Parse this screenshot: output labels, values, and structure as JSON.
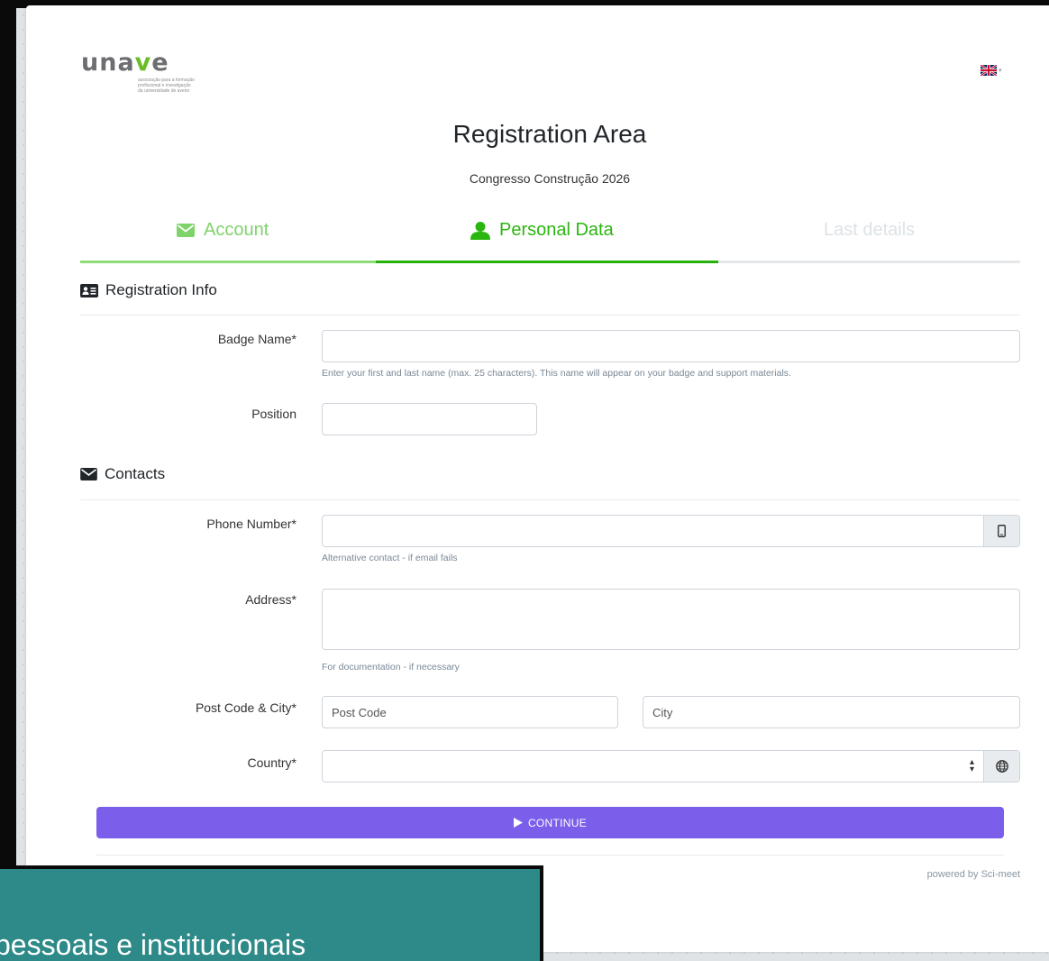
{
  "header": {
    "logo": {
      "word_start": "una",
      "word_v": "v",
      "word_end": "e",
      "tagline": [
        "associação para a formação",
        "profissional e investigação",
        "da universidade de aveiro"
      ]
    },
    "language_icon": "uk-flag-icon",
    "title": "Registration Area",
    "subtitle": "Congresso Construção 2026"
  },
  "steps": [
    {
      "label": "Account",
      "icon": "envelope-icon",
      "state": "done"
    },
    {
      "label": "Personal Data",
      "icon": "user-icon",
      "state": "active"
    },
    {
      "label": "Last details",
      "icon": "",
      "state": "pending"
    }
  ],
  "sections": {
    "registration": {
      "title": "Registration Info",
      "icon": "id-card-icon"
    },
    "contacts": {
      "title": "Contacts",
      "icon": "envelope-icon"
    }
  },
  "fields": {
    "badge_name": {
      "label": "Badge Name*",
      "value": "",
      "help": "Enter your first and last name (max. 25 characters). This name will appear on your badge and support materials."
    },
    "position": {
      "label": "Position",
      "value": ""
    },
    "phone": {
      "label": "Phone Number*",
      "value": "",
      "help": "Alternative contact - if email fails",
      "addon_icon": "mobile-phone-icon"
    },
    "address": {
      "label": "Address*",
      "value": "",
      "help": "For documentation - if necessary"
    },
    "post_city": {
      "label": "Post Code & City*",
      "post_placeholder": "Post Code",
      "city_placeholder": "City"
    },
    "country": {
      "label": "Country*",
      "value": "",
      "addon_icon": "globe-icon"
    }
  },
  "actions": {
    "continue_label": "CONTINUE"
  },
  "footer": {
    "powered_by": "powered by Sci-meet"
  },
  "overlay": {
    "text": "pessoais e institucionais"
  },
  "colors": {
    "primary_button": "#7b5fea",
    "step_active": "#2bb60f",
    "step_done": "#7ed36a",
    "overlay_bg": "#2d8a88"
  }
}
